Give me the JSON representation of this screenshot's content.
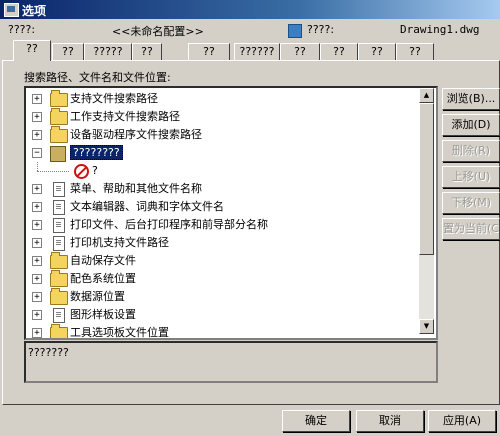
{
  "window": {
    "title": "选项"
  },
  "profile": {
    "current_label": "????:",
    "current_value": "<<未命名配置>>",
    "drawing_label": "????:",
    "drawing_value": "Drawing1.dwg"
  },
  "tabs": [
    "??",
    "??",
    "?????",
    "??",
    "??",
    "??????",
    "??",
    "??",
    "??",
    "??"
  ],
  "section_label": "搜索路径、文件名和文件位置:",
  "tree": [
    {
      "label": "支持文件搜索路径",
      "icon": "folder-icon",
      "expander": "+"
    },
    {
      "label": "工作支持文件搜索路径",
      "icon": "folder-icon",
      "expander": "+"
    },
    {
      "label": "设备驱动程序文件搜索路径",
      "icon": "folder-icon",
      "expander": "+"
    },
    {
      "label": "????????",
      "icon": "file-cabinet-icon",
      "expander": "−",
      "selected": true
    },
    {
      "label": "?",
      "icon": "no-entry-icon",
      "expander": "",
      "child": true
    },
    {
      "label": "菜单、帮助和其他文件名称",
      "icon": "document-icon",
      "expander": "+"
    },
    {
      "label": "文本编辑器、词典和字体文件名",
      "icon": "document-icon",
      "expander": "+"
    },
    {
      "label": "打印文件、后台打印程序和前导部分名称",
      "icon": "document-icon",
      "expander": "+"
    },
    {
      "label": "打印机支持文件路径",
      "icon": "document-icon",
      "expander": "+"
    },
    {
      "label": "自动保存文件",
      "icon": "folder-icon",
      "expander": "+"
    },
    {
      "label": "配色系统位置",
      "icon": "folder-icon",
      "expander": "+"
    },
    {
      "label": "数据源位置",
      "icon": "folder-icon",
      "expander": "+"
    },
    {
      "label": "图形样板设置",
      "icon": "document-icon",
      "expander": "+"
    },
    {
      "label": "工具选项板文件位置",
      "icon": "folder-icon",
      "expander": "+"
    }
  ],
  "side_buttons": {
    "browse": "浏览(B)...",
    "add": "添加(D)",
    "remove": "删除(R)",
    "move_up": "上移(U)",
    "move_down": "下移(M)",
    "set_current": "置为当前(C)"
  },
  "description": "???????",
  "footer": {
    "ok": "确定",
    "cancel": "取消",
    "apply": "应用(A)"
  },
  "colors": {
    "titlebar": "#0a246a",
    "selection": "#0a246a",
    "face": "#d4d0c8"
  }
}
